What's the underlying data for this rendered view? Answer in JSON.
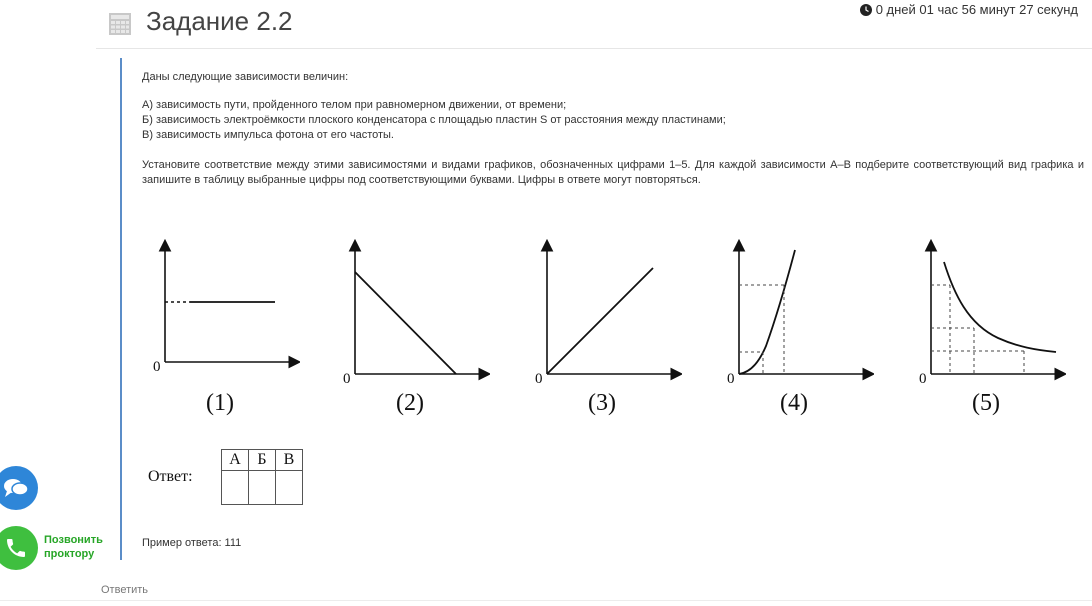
{
  "header": {
    "title": "Задание 2.2",
    "timer": "0 дней 01 час 56 минут 27 секунд"
  },
  "task": {
    "intro": "Даны следующие зависимости величин:",
    "items": [
      "А) зависимость пути, пройденного телом при равномерном движении, от времени;",
      "Б) зависимость электроёмкости плоского конденсатора с площадью пластин S от расстояния между пластинами;",
      "В) зависимость импульса фотона от его частоты."
    ],
    "instruction": "Установите соответствие между этими зависимостями и видами графиков, обозначенных цифрами 1–5. Для каждой зависимости А–В подберите соответствующий вид графика и запишите в таблицу выбранные цифры под соответствующими буквами. Цифры в ответе могут повторяться."
  },
  "graphs": {
    "labels": [
      "(1)",
      "(2)",
      "(3)",
      "(4)",
      "(5)"
    ],
    "origin": "0"
  },
  "answer": {
    "label": "Ответ:",
    "columns": [
      "А",
      "Б",
      "В"
    ]
  },
  "example": "Пример ответа: 111",
  "call_proctor": {
    "line1": "Позвонить",
    "line2": "проктору"
  },
  "answer_button": "Ответить",
  "colors": {
    "accent_line": "#5b8dc8",
    "chat_button": "#2e86d8",
    "call_button": "#3fbf3f"
  }
}
